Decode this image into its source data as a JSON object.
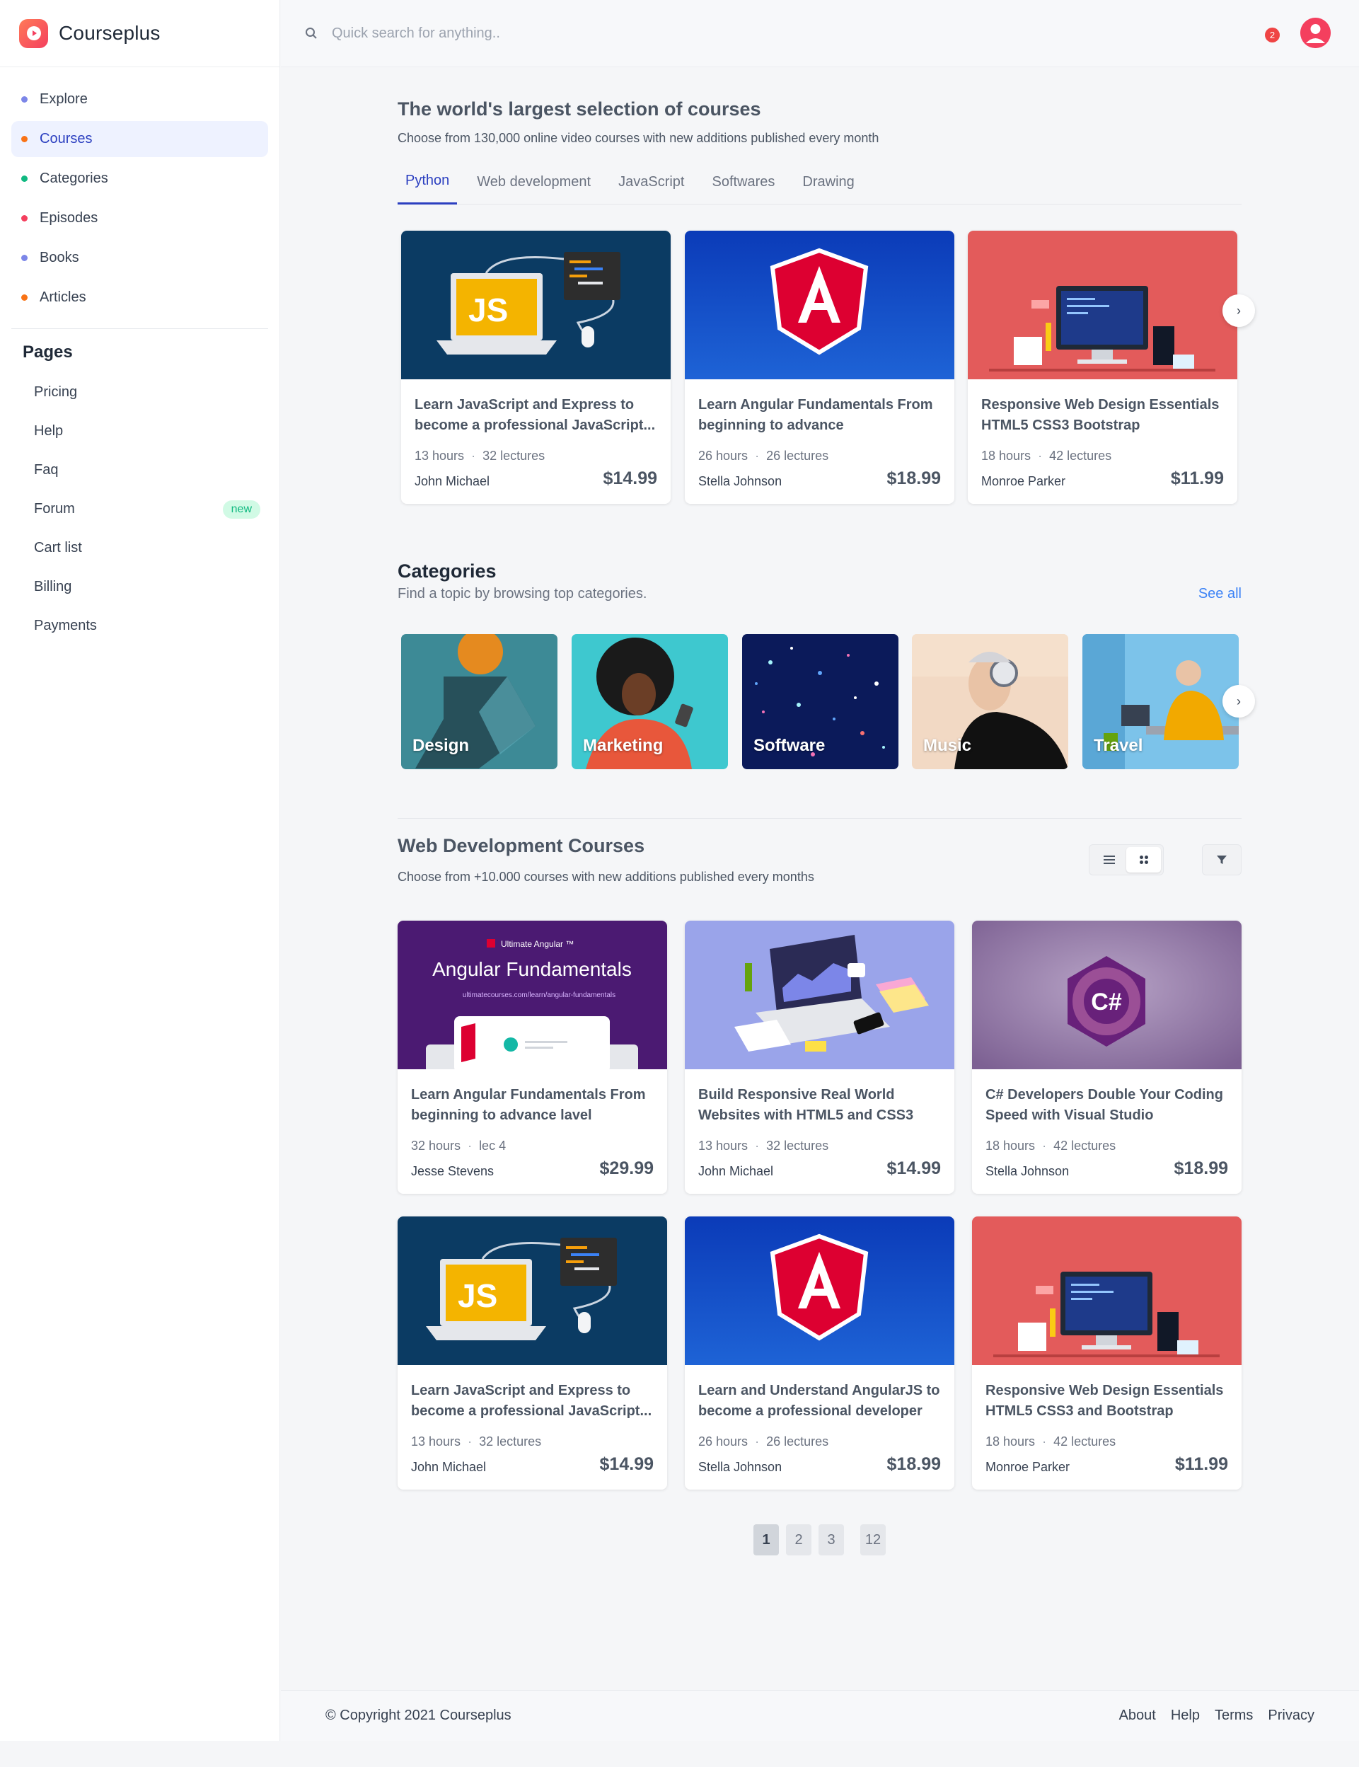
{
  "brand": {
    "name": "Courseplus",
    "logo_icon": "play-icon",
    "accent": "#f43f5e"
  },
  "header": {
    "search_placeholder": "Quick search for anything..",
    "search_icon": "search-icon",
    "notification_count": "2"
  },
  "sidebar": {
    "items": [
      {
        "label": "Explore",
        "dot": "#7c86e8",
        "active": false
      },
      {
        "label": "Courses",
        "dot": "#f97316",
        "active": true
      },
      {
        "label": "Categories",
        "dot": "#10b981",
        "active": false
      },
      {
        "label": "Episodes",
        "dot": "#f43f5e",
        "active": false
      },
      {
        "label": "Books",
        "dot": "#7c86e8",
        "active": false
      },
      {
        "label": "Articles",
        "dot": "#f97316",
        "active": false
      }
    ],
    "pages_title": "Pages",
    "pages": [
      {
        "label": "Pricing"
      },
      {
        "label": "Help"
      },
      {
        "label": "Faq"
      },
      {
        "label": "Forum",
        "badge": "new"
      },
      {
        "label": "Cart list"
      },
      {
        "label": "Billing"
      },
      {
        "label": "Payments"
      }
    ]
  },
  "hero": {
    "title": "The world's largest selection of courses",
    "subtitle": "Choose from 130,000 online video courses with new additions published every month",
    "tabs": [
      "Python",
      "Web development",
      "JavaScript",
      "Softwares",
      "Drawing"
    ],
    "active_tab": "Python"
  },
  "featured_courses": [
    {
      "title": "Learn JavaScript and Express to become a professional JavaScript...",
      "hours": "13 hours",
      "lectures": "32 lectures",
      "author": "John Michael",
      "price": "$14.99",
      "thumb": "js"
    },
    {
      "title": "Learn Angular Fundamentals From beginning to advance",
      "hours": "26 hours",
      "lectures": "26 lectures",
      "author": "Stella Johnson",
      "price": "$18.99",
      "thumb": "angular"
    },
    {
      "title": "Responsive Web Design Essentials HTML5 CSS3 Bootstrap",
      "hours": "18 hours",
      "lectures": "42 lectures",
      "author": "Monroe Parker",
      "price": "$11.99",
      "thumb": "web"
    }
  ],
  "categories": {
    "title": "Categories",
    "subtitle": "Find a topic by browsing top categories.",
    "see_all": "See all",
    "items": [
      {
        "label": "Design"
      },
      {
        "label": "Marketing"
      },
      {
        "label": "Software"
      },
      {
        "label": "Music"
      },
      {
        "label": "Travel"
      }
    ]
  },
  "web_dev": {
    "title": "Web Development Courses",
    "subtitle": "Choose from +10.000 courses with new additions published every months",
    "courses": [
      {
        "title": "Learn Angular Fundamentals From beginning to advance lavel",
        "hours": "32 hours",
        "lectures": "lec 4",
        "author": "Jesse Stevens",
        "price": "$29.99",
        "thumb": "ultimate",
        "thumb_text": {
          "badge": "Ultimate Angular ™",
          "heading": "Angular Fundamentals",
          "url": "ultimatecourses.com/learn/angular-fundamentals"
        }
      },
      {
        "title": "Build Responsive Real World Websites with HTML5 and CSS3",
        "hours": "13 hours",
        "lectures": "32 lectures",
        "author": "John Michael",
        "price": "$14.99",
        "thumb": "laptop"
      },
      {
        "title": "C# Developers Double Your Coding Speed with Visual Studio",
        "hours": "18 hours",
        "lectures": "42 lectures",
        "author": "Stella Johnson",
        "price": "$18.99",
        "thumb": "csharp",
        "thumb_text": {
          "logo": "C#"
        }
      },
      {
        "title": "Learn JavaScript and Express to become a professional JavaScript...",
        "hours": "13 hours",
        "lectures": "32 lectures",
        "author": "John Michael",
        "price": "$14.99",
        "thumb": "js"
      },
      {
        "title": "Learn and Understand AngularJS to become a professional developer",
        "hours": "26 hours",
        "lectures": "26 lectures",
        "author": "Stella Johnson",
        "price": "$18.99",
        "thumb": "angular"
      },
      {
        "title": "Responsive Web Design Essentials HTML5 CSS3 and Bootstrap",
        "hours": "18 hours",
        "lectures": "42 lectures",
        "author": "Monroe Parker",
        "price": "$11.99",
        "thumb": "web"
      }
    ]
  },
  "pagination": [
    "1",
    "2",
    "3",
    "12"
  ],
  "footer": {
    "copyright": "© Copyright 2021 Courseplus",
    "links": [
      "About",
      "Help",
      "Terms",
      "Privacy"
    ]
  }
}
